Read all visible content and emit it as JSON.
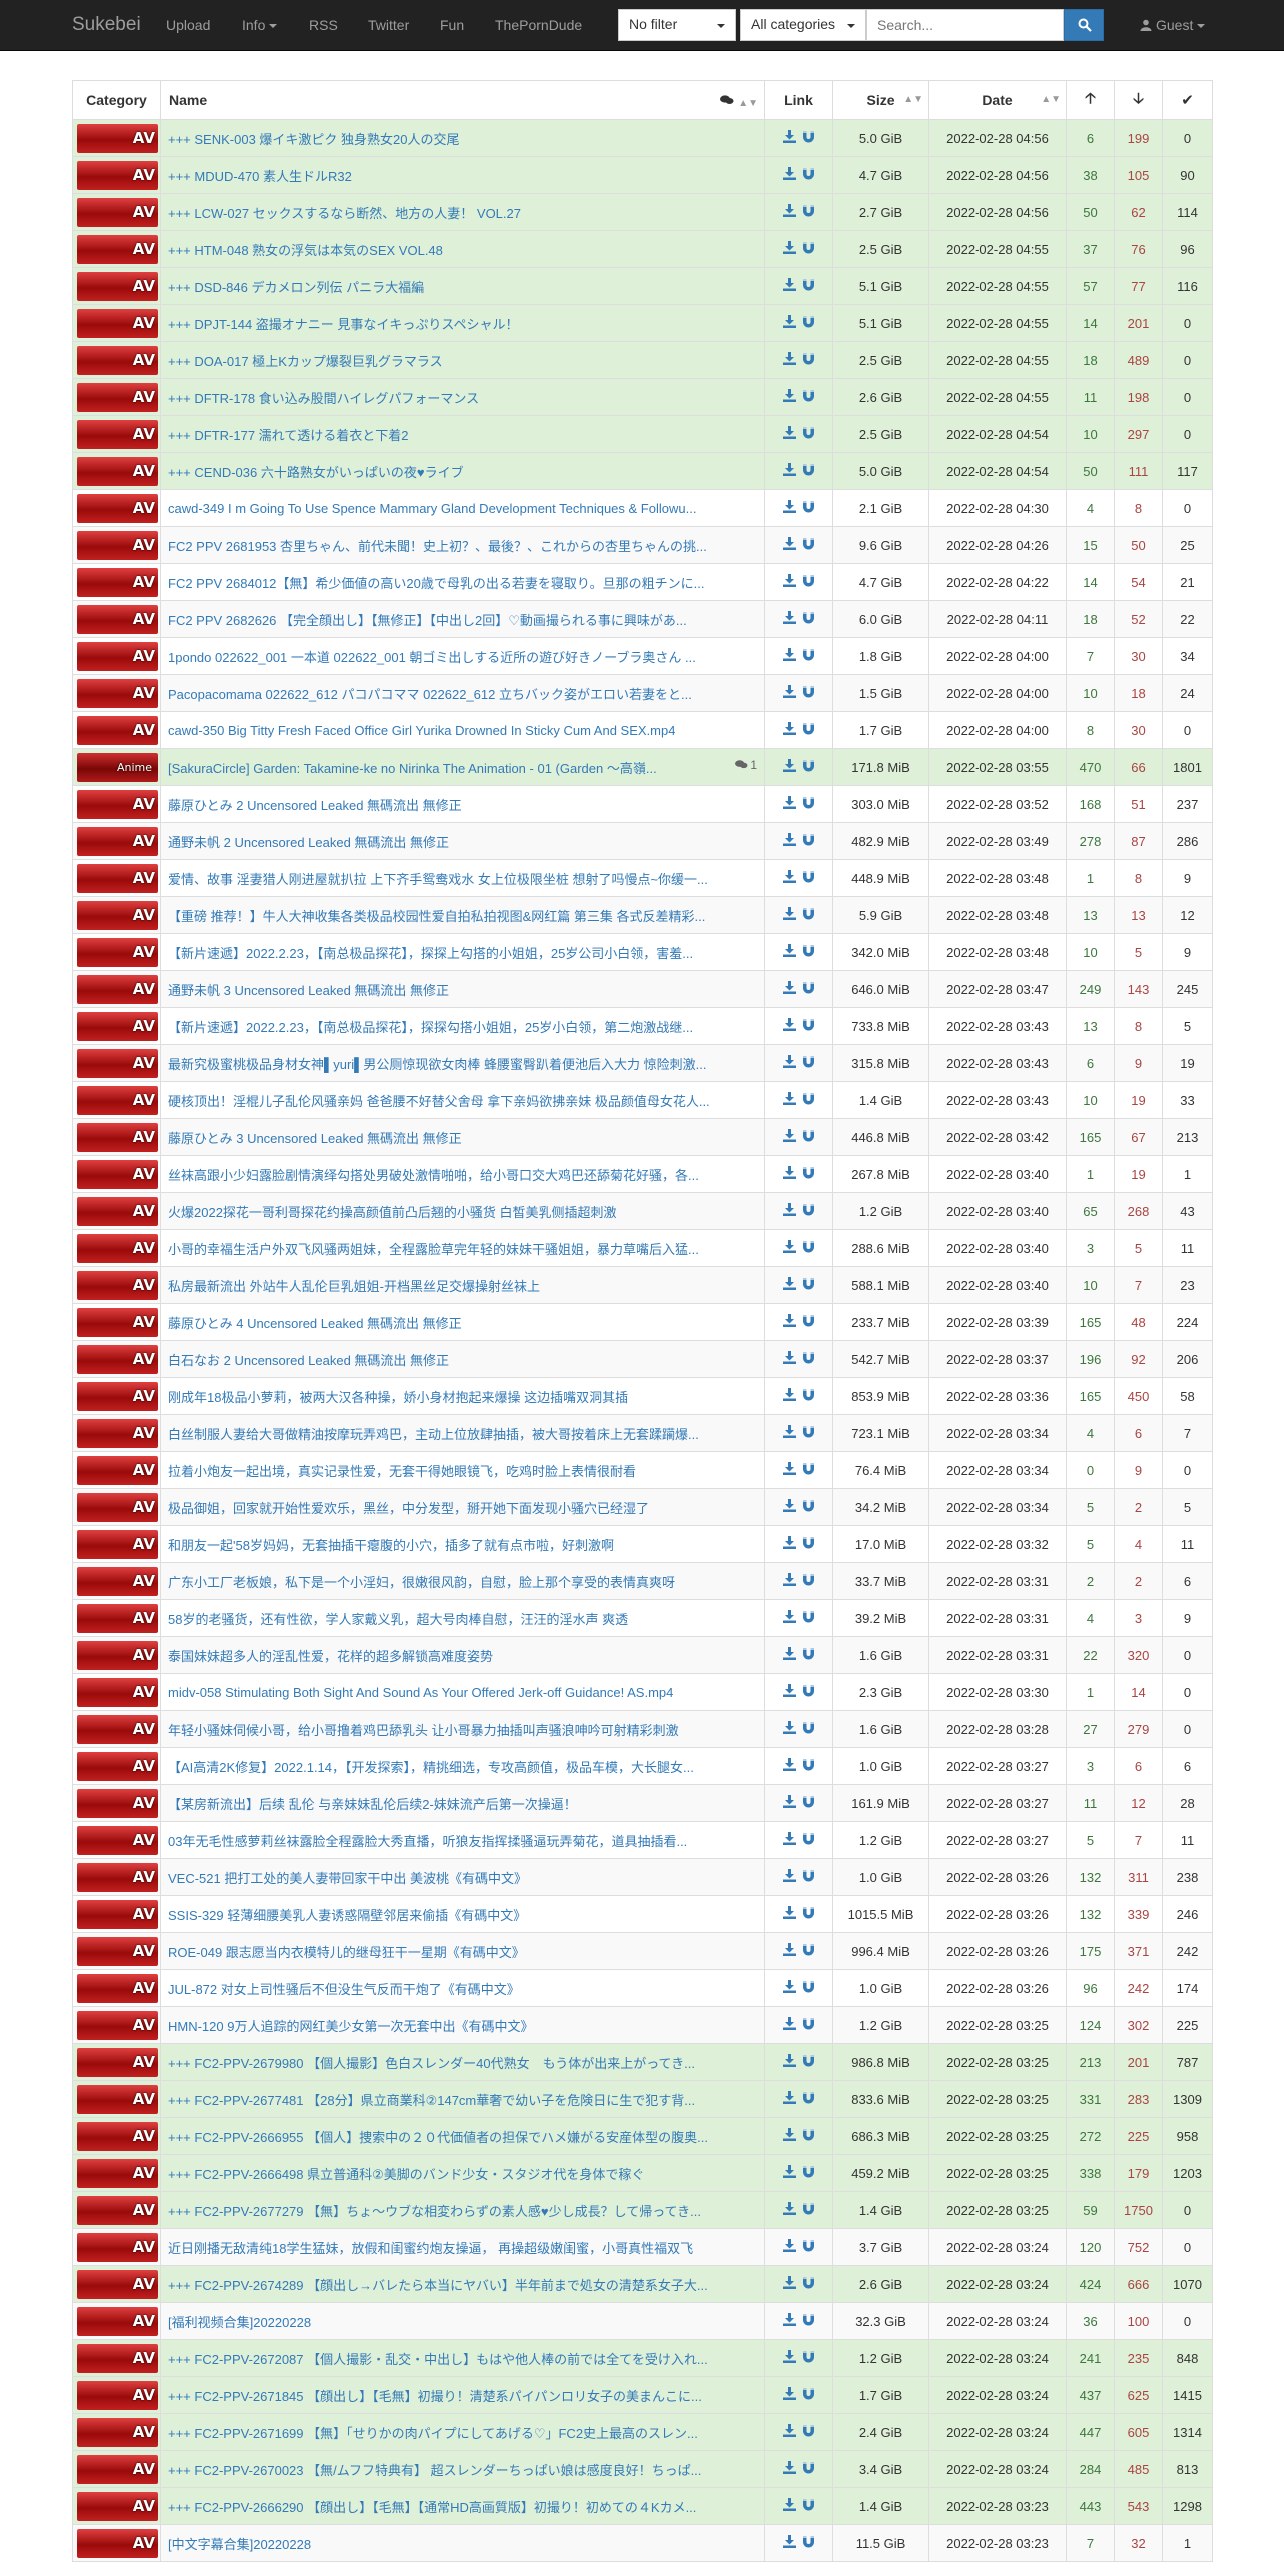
{
  "navbar": {
    "brand": "Sukebei",
    "items": [
      "Upload",
      "Info",
      "RSS",
      "Twitter",
      "Fun",
      "ThePornDude"
    ],
    "filter_value": "No filter",
    "category_value": "All categories",
    "search_placeholder": "Search...",
    "guest_label": "Guest"
  },
  "table": {
    "headers": {
      "category": "Category",
      "name": "Name",
      "link": "Link",
      "size": "Size",
      "date": "Date"
    },
    "rows": [
      {
        "cat": "AV",
        "name": "+++ SENK-003 爆イキ激ピク 独身熟女20人の交尾",
        "size": "5.0 GiB",
        "date": "2022-02-28 04:56",
        "seed": "6",
        "leech": "199",
        "done": "0",
        "trusted": true
      },
      {
        "cat": "AV",
        "name": "+++ MDUD-470 素人生ドルR32",
        "size": "4.7 GiB",
        "date": "2022-02-28 04:56",
        "seed": "38",
        "leech": "105",
        "done": "90",
        "trusted": true
      },
      {
        "cat": "AV",
        "name": "+++ LCW-027 セックスするなら断然、地方の人妻！ VOL.27",
        "size": "2.7 GiB",
        "date": "2022-02-28 04:56",
        "seed": "50",
        "leech": "62",
        "done": "114",
        "trusted": true
      },
      {
        "cat": "AV",
        "name": "+++ HTM-048 熟女の浮気は本気のSEX VOL.48",
        "size": "2.5 GiB",
        "date": "2022-02-28 04:55",
        "seed": "37",
        "leech": "76",
        "done": "96",
        "trusted": true
      },
      {
        "cat": "AV",
        "name": "+++ DSD-846 デカメロン列伝 パニラ大福編",
        "size": "5.1 GiB",
        "date": "2022-02-28 04:55",
        "seed": "57",
        "leech": "77",
        "done": "116",
        "trusted": true
      },
      {
        "cat": "AV",
        "name": "+++ DPJT-144 盗撮オナニー 見事なイキっぷりスペシャル！",
        "size": "5.1 GiB",
        "date": "2022-02-28 04:55",
        "seed": "14",
        "leech": "201",
        "done": "0",
        "trusted": true
      },
      {
        "cat": "AV",
        "name": "+++ DOA-017 極上Kカップ爆裂巨乳グラマラス",
        "size": "2.5 GiB",
        "date": "2022-02-28 04:55",
        "seed": "18",
        "leech": "489",
        "done": "0",
        "trusted": true
      },
      {
        "cat": "AV",
        "name": "+++ DFTR-178 食い込み股間ハイレグパフォーマンス",
        "size": "2.6 GiB",
        "date": "2022-02-28 04:55",
        "seed": "11",
        "leech": "198",
        "done": "0",
        "trusted": true
      },
      {
        "cat": "AV",
        "name": "+++ DFTR-177 濡れて透ける着衣と下着2",
        "size": "2.5 GiB",
        "date": "2022-02-28 04:54",
        "seed": "10",
        "leech": "297",
        "done": "0",
        "trusted": true
      },
      {
        "cat": "AV",
        "name": "+++ CEND-036 六十路熟女がいっぱいの夜♥ライブ",
        "size": "5.0 GiB",
        "date": "2022-02-28 04:54",
        "seed": "50",
        "leech": "111",
        "done": "117",
        "trusted": true
      },
      {
        "cat": "AV",
        "name": "cawd-349 I m Going To Use Spence Mammary Gland Development Techniques & Followu...",
        "size": "2.1 GiB",
        "date": "2022-02-28 04:30",
        "seed": "4",
        "leech": "8",
        "done": "0",
        "trusted": false
      },
      {
        "cat": "AV",
        "name": "FC2 PPV 2681953 杏里ちゃん、前代未聞！史上初？、最後？、これからの杏里ちゃんの挑...",
        "size": "9.6 GiB",
        "date": "2022-02-28 04:26",
        "seed": "15",
        "leech": "50",
        "done": "25",
        "trusted": false
      },
      {
        "cat": "AV",
        "name": "FC2 PPV 2684012【無】希少価値の高い20歳で母乳の出る若妻を寝取り。旦那の粗チンに...",
        "size": "4.7 GiB",
        "date": "2022-02-28 04:22",
        "seed": "14",
        "leech": "54",
        "done": "21",
        "trusted": false
      },
      {
        "cat": "AV",
        "name": "FC2 PPV 2682626 【完全顔出し】【無修正】【中出し2回】♡動画撮られる事に興味があ...",
        "size": "6.0 GiB",
        "date": "2022-02-28 04:11",
        "seed": "18",
        "leech": "52",
        "done": "22",
        "trusted": false
      },
      {
        "cat": "AV",
        "name": "1pondo 022622_001 一本道 022622_001 朝ゴミ出しする近所の遊び好きノーブラ奥さん ...",
        "size": "1.8 GiB",
        "date": "2022-02-28 04:00",
        "seed": "7",
        "leech": "30",
        "done": "34",
        "trusted": false
      },
      {
        "cat": "AV",
        "name": "Pacopacomama 022622_612 パコパコママ 022622_612 立ちバック姿がエロい若妻をと...",
        "size": "1.5 GiB",
        "date": "2022-02-28 04:00",
        "seed": "10",
        "leech": "18",
        "done": "24",
        "trusted": false
      },
      {
        "cat": "AV",
        "name": "cawd-350 Big Titty Fresh Faced Office Girl Yurika Drowned In Sticky Cum And SEX.mp4",
        "size": "1.7 GiB",
        "date": "2022-02-28 04:00",
        "seed": "8",
        "leech": "30",
        "done": "0",
        "trusted": false
      },
      {
        "cat": "Anime",
        "name": "[SakuraCircle] Garden: Takamine-ke no Nirinka The Animation - 01 (Garden 〜高嶺...",
        "comments": "1",
        "size": "171.8 MiB",
        "date": "2022-02-28 03:55",
        "seed": "470",
        "leech": "66",
        "done": "1801",
        "trusted": true
      },
      {
        "cat": "AV",
        "name": "藤原ひとみ 2 Uncensored Leaked 無碼流出 無修正",
        "size": "303.0 MiB",
        "date": "2022-02-28 03:52",
        "seed": "168",
        "leech": "51",
        "done": "237",
        "trusted": false
      },
      {
        "cat": "AV",
        "name": "通野未帆 2 Uncensored Leaked 無碼流出 無修正",
        "size": "482.9 MiB",
        "date": "2022-02-28 03:49",
        "seed": "278",
        "leech": "87",
        "done": "286",
        "trusted": false
      },
      {
        "cat": "AV",
        "name": "爱情、故事 淫妻猎人刚进屋就扒拉 上下齐手鸳鸯戏水 女上位极限坐桩 想射了吗慢点~你缓一...",
        "size": "448.9 MiB",
        "date": "2022-02-28 03:48",
        "seed": "1",
        "leech": "8",
        "done": "9",
        "trusted": false
      },
      {
        "cat": "AV",
        "name": "【重磅 推荐！】牛人大神收集各类极品校园性爱自拍私拍视图&网红篇 第三集 各式反差精彩...",
        "size": "5.9 GiB",
        "date": "2022-02-28 03:48",
        "seed": "13",
        "leech": "13",
        "done": "12",
        "trusted": false
      },
      {
        "cat": "AV",
        "name": "【新片速遞】2022.2.23，【南总极品探花】，探探上勾搭的小姐姐，25岁公司小白领，害羞...",
        "size": "342.0 MiB",
        "date": "2022-02-28 03:48",
        "seed": "10",
        "leech": "5",
        "done": "9",
        "trusted": false
      },
      {
        "cat": "AV",
        "name": "通野未帆 3 Uncensored Leaked 無碼流出 無修正",
        "size": "646.0 MiB",
        "date": "2022-02-28 03:47",
        "seed": "249",
        "leech": "143",
        "done": "245",
        "trusted": false
      },
      {
        "cat": "AV",
        "name": "【新片速遞】2022.2.23，【南总极品探花】，探探勾搭小姐姐，25岁小白领，第二炮激战继...",
        "size": "733.8 MiB",
        "date": "2022-02-28 03:43",
        "seed": "13",
        "leech": "8",
        "done": "5",
        "trusted": false
      },
      {
        "cat": "AV",
        "name": "最新究极蜜桃极品身材女神▌yuri▌男公厕惊现欲女肉棒 蜂腰蜜臀趴着便池后入大力 惊险刺激...",
        "size": "315.8 MiB",
        "date": "2022-02-28 03:43",
        "seed": "6",
        "leech": "9",
        "done": "19",
        "trusted": false
      },
      {
        "cat": "AV",
        "name": "硬核顶出！淫棍儿子乱伦风骚亲妈 爸爸腰不好替父舍母 拿下亲妈欲拂亲妹 极品颜值母女花人...",
        "size": "1.4 GiB",
        "date": "2022-02-28 03:43",
        "seed": "10",
        "leech": "19",
        "done": "33",
        "trusted": false
      },
      {
        "cat": "AV",
        "name": "藤原ひとみ 3 Uncensored Leaked 無碼流出 無修正",
        "size": "446.8 MiB",
        "date": "2022-02-28 03:42",
        "seed": "165",
        "leech": "67",
        "done": "213",
        "trusted": false
      },
      {
        "cat": "AV",
        "name": "丝袜高跟小少妇露脸剧情演绎勾搭处男破处激情啪啪，给小哥口交大鸡巴还舔菊花好骚，各...",
        "size": "267.8 MiB",
        "date": "2022-02-28 03:40",
        "seed": "1",
        "leech": "19",
        "done": "1",
        "trusted": false
      },
      {
        "cat": "AV",
        "name": "火爆2022探花一哥利哥探花约操高颜值前凸后翘的小骚货 白皙美乳侧插超刺激",
        "size": "1.2 GiB",
        "date": "2022-02-28 03:40",
        "seed": "65",
        "leech": "268",
        "done": "43",
        "trusted": false
      },
      {
        "cat": "AV",
        "name": "小哥的幸福生活户外双飞风骚两姐妹，全程露脸草完年轻的妹妹干骚姐姐，暴力草嘴后入猛...",
        "size": "288.6 MiB",
        "date": "2022-02-28 03:40",
        "seed": "3",
        "leech": "5",
        "done": "11",
        "trusted": false
      },
      {
        "cat": "AV",
        "name": "私房最新流出 外站牛人乱伦巨乳姐姐-开档黑丝足交爆操射丝袜上",
        "size": "588.1 MiB",
        "date": "2022-02-28 03:40",
        "seed": "10",
        "leech": "7",
        "done": "23",
        "trusted": false
      },
      {
        "cat": "AV",
        "name": "藤原ひとみ 4 Uncensored Leaked 無碼流出 無修正",
        "size": "233.7 MiB",
        "date": "2022-02-28 03:39",
        "seed": "165",
        "leech": "48",
        "done": "224",
        "trusted": false
      },
      {
        "cat": "AV",
        "name": "白石なお 2 Uncensored Leaked 無碼流出 無修正",
        "size": "542.7 MiB",
        "date": "2022-02-28 03:37",
        "seed": "196",
        "leech": "92",
        "done": "206",
        "trusted": false
      },
      {
        "cat": "AV",
        "name": "刚成年18极品小萝莉，被两大汉各种操，娇小身材抱起来爆操 这边插嘴双洞其插",
        "size": "853.9 MiB",
        "date": "2022-02-28 03:36",
        "seed": "165",
        "leech": "450",
        "done": "58",
        "trusted": false
      },
      {
        "cat": "AV",
        "name": "白丝制服人妻给大哥做精油按摩玩弄鸡巴，主动上位放肆抽插，被大哥按着床上无套蹂躏爆...",
        "size": "723.1 MiB",
        "date": "2022-02-28 03:34",
        "seed": "4",
        "leech": "6",
        "done": "7",
        "trusted": false
      },
      {
        "cat": "AV",
        "name": "拉着小炮友一起出境，真实记录性爱，无套干得她眼镜飞，吃鸡时脸上表情很耐看",
        "size": "76.4 MiB",
        "date": "2022-02-28 03:34",
        "seed": "0",
        "leech": "9",
        "done": "0",
        "trusted": false
      },
      {
        "cat": "AV",
        "name": "极品御姐，回家就开始性爱欢乐，黑丝，中分发型，掰开她下面发现小骚穴已经湿了",
        "size": "34.2 MiB",
        "date": "2022-02-28 03:34",
        "seed": "5",
        "leech": "2",
        "done": "5",
        "trusted": false
      },
      {
        "cat": "AV",
        "name": "和朋友一起'58岁妈妈，无套抽插干瘪腹的小穴，插多了就有点市啦，好刺激啊",
        "size": "17.0 MiB",
        "date": "2022-02-28 03:32",
        "seed": "5",
        "leech": "4",
        "done": "11",
        "trusted": false
      },
      {
        "cat": "AV",
        "name": "广东小工厂老板娘，私下是一个小淫妇，很嫩很风韵，自慰，脸上那个享受的表情真爽呀",
        "size": "33.7 MiB",
        "date": "2022-02-28 03:31",
        "seed": "2",
        "leech": "2",
        "done": "6",
        "trusted": false
      },
      {
        "cat": "AV",
        "name": "58岁的老骚货，还有性欲，学人家戴义乳，超大号肉棒自慰，汪汪的淫水声 爽透",
        "size": "39.2 MiB",
        "date": "2022-02-28 03:31",
        "seed": "4",
        "leech": "3",
        "done": "9",
        "trusted": false
      },
      {
        "cat": "AV",
        "name": "泰国妹妹超多人的淫乱性爱，花样的超多解锁高难度姿势",
        "size": "1.6 GiB",
        "date": "2022-02-28 03:31",
        "seed": "22",
        "leech": "320",
        "done": "0",
        "trusted": false
      },
      {
        "cat": "AV",
        "name": "midv-058 Stimulating Both Sight And Sound As Your Offered Jerk-off Guidance! AS.mp4",
        "size": "2.3 GiB",
        "date": "2022-02-28 03:30",
        "seed": "1",
        "leech": "14",
        "done": "0",
        "trusted": false
      },
      {
        "cat": "AV",
        "name": "年轻小骚妹伺候小哥，给小哥撸着鸡巴舔乳头 让小哥暴力抽插叫声骚浪呻吟可射精彩刺激",
        "size": "1.6 GiB",
        "date": "2022-02-28 03:28",
        "seed": "27",
        "leech": "279",
        "done": "0",
        "trusted": false
      },
      {
        "cat": "AV",
        "name": "【AI高清2K修复】2022.1.14，【开发探索】，精挑细选，专攻高颜值，极品车模，大长腿女...",
        "size": "1.0 GiB",
        "date": "2022-02-28 03:27",
        "seed": "3",
        "leech": "6",
        "done": "6",
        "trusted": false
      },
      {
        "cat": "AV",
        "name": "【某房新流出】后续 乱伦 与亲妹妹乱伦后续2-妹妹流产后第一次操逼！",
        "size": "161.9 MiB",
        "date": "2022-02-28 03:27",
        "seed": "11",
        "leech": "12",
        "done": "28",
        "trusted": false
      },
      {
        "cat": "AV",
        "name": "03年无毛性感萝莉丝袜露脸全程露脸大秀直播，听狼友指挥揉骚逼玩弄菊花，道具抽插看...",
        "size": "1.2 GiB",
        "date": "2022-02-28 03:27",
        "seed": "5",
        "leech": "7",
        "done": "11",
        "trusted": false
      },
      {
        "cat": "AV",
        "name": "VEC-521 把打工处的美人妻带回家干中出 美波桃《有碼中文》",
        "size": "1.0 GiB",
        "date": "2022-02-28 03:26",
        "seed": "132",
        "leech": "311",
        "done": "238",
        "trusted": false
      },
      {
        "cat": "AV",
        "name": "SSIS-329 轻薄细腰美乳人妻诱惑隔壁邻居来偷插《有碼中文》",
        "size": "1015.5 MiB",
        "date": "2022-02-28 03:26",
        "seed": "132",
        "leech": "339",
        "done": "246",
        "trusted": false
      },
      {
        "cat": "AV",
        "name": "ROE-049 跟志愿当内衣模特儿的继母狂干一星期《有碼中文》",
        "size": "996.4 MiB",
        "date": "2022-02-28 03:26",
        "seed": "175",
        "leech": "371",
        "done": "242",
        "trusted": false
      },
      {
        "cat": "AV",
        "name": "JUL-872 对女上司性骚后不但没生气反而干炮了《有碼中文》",
        "size": "1.0 GiB",
        "date": "2022-02-28 03:26",
        "seed": "96",
        "leech": "242",
        "done": "174",
        "trusted": false
      },
      {
        "cat": "AV",
        "name": "HMN-120 9万人追踪的网红美少女第一次无套中出《有碼中文》",
        "size": "1.2 GiB",
        "date": "2022-02-28 03:25",
        "seed": "124",
        "leech": "302",
        "done": "225",
        "trusted": false
      },
      {
        "cat": "AV",
        "name": "+++ FC2-PPV-2679980 【個人撮影】色白スレンダー40代熟女　もう体が出来上がってき...",
        "size": "986.8 MiB",
        "date": "2022-02-28 03:25",
        "seed": "213",
        "leech": "201",
        "done": "787",
        "trusted": true
      },
      {
        "cat": "AV",
        "name": "+++ FC2-PPV-2677481 【28分】県立商業科②147cm華奢で幼い子を危険日に生で犯す背...",
        "size": "833.6 MiB",
        "date": "2022-02-28 03:25",
        "seed": "331",
        "leech": "283",
        "done": "1309",
        "trusted": true
      },
      {
        "cat": "AV",
        "name": "+++ FC2-PPV-2666955 【個人】捜索中の２０代価値者の担保でハメ嫌がる安産体型の腹奥...",
        "size": "686.3 MiB",
        "date": "2022-02-28 03:25",
        "seed": "272",
        "leech": "225",
        "done": "958",
        "trusted": true
      },
      {
        "cat": "AV",
        "name": "+++ FC2-PPV-2666498 県立普通科②美脚のバンド少女・スタジオ代を身体で稼ぐ",
        "size": "459.2 MiB",
        "date": "2022-02-28 03:25",
        "seed": "338",
        "leech": "179",
        "done": "1203",
        "trusted": true
      },
      {
        "cat": "AV",
        "name": "+++ FC2-PPV-2677279 【無】ちょ〜ウブな相変わらずの素人感♥少し成長？して帰ってき...",
        "size": "1.4 GiB",
        "date": "2022-02-28 03:25",
        "seed": "59",
        "leech": "1750",
        "done": "0",
        "trusted": true
      },
      {
        "cat": "AV",
        "name": "近日刚播无敌清纯18学生猛妹，放假和闺蜜约炮友操逼， 再操超级嫩闺蜜，小哥真性福双飞",
        "size": "3.7 GiB",
        "date": "2022-02-28 03:24",
        "seed": "120",
        "leech": "752",
        "done": "0",
        "trusted": false
      },
      {
        "cat": "AV",
        "name": "+++ FC2-PPV-2674289 【顔出し→バレたら本当にヤバい】半年前まで処女の清楚系女子大...",
        "size": "2.6 GiB",
        "date": "2022-02-28 03:24",
        "seed": "424",
        "leech": "666",
        "done": "1070",
        "trusted": true
      },
      {
        "cat": "AV",
        "name": "[福利视频合集]20220228",
        "size": "32.3 GiB",
        "date": "2022-02-28 03:24",
        "seed": "36",
        "leech": "100",
        "done": "0",
        "trusted": false
      },
      {
        "cat": "AV",
        "name": "+++ FC2-PPV-2672087 【個人撮影・乱交・中出し】もはや他人棒の前では全てを受け入れ...",
        "size": "1.2 GiB",
        "date": "2022-02-28 03:24",
        "seed": "241",
        "leech": "235",
        "done": "848",
        "trusted": true
      },
      {
        "cat": "AV",
        "name": "+++ FC2-PPV-2671845 【顔出し】【毛無】初撮り！清楚系パイパンロリ女子の美まんこに...",
        "size": "1.7 GiB",
        "date": "2022-02-28 03:24",
        "seed": "437",
        "leech": "625",
        "done": "1415",
        "trusted": true
      },
      {
        "cat": "AV",
        "name": "+++ FC2-PPV-2671699 【無】「せりかの肉パイプにしてあげる♡」FC2史上最高のスレン...",
        "size": "2.4 GiB",
        "date": "2022-02-28 03:24",
        "seed": "447",
        "leech": "605",
        "done": "1314",
        "trusted": true
      },
      {
        "cat": "AV",
        "name": "+++ FC2-PPV-2670023 【無/ムフフ特典有】 超スレンダーちっぱい娘は感度良好！ちっぱ...",
        "size": "3.4 GiB",
        "date": "2022-02-28 03:24",
        "seed": "284",
        "leech": "485",
        "done": "813",
        "trusted": true
      },
      {
        "cat": "AV",
        "name": "+++ FC2-PPV-2666290 【顔出し】【毛無】【通常HD高画質版】初撮り！初めての４Kカメ...",
        "size": "1.4 GiB",
        "date": "2022-02-28 03:23",
        "seed": "443",
        "leech": "543",
        "done": "1298",
        "trusted": true
      },
      {
        "cat": "AV",
        "name": "[中文字幕合集]20220228",
        "size": "11.5 GiB",
        "date": "2022-02-28 03:23",
        "seed": "7",
        "leech": "32",
        "done": "1",
        "trusted": false
      }
    ]
  }
}
